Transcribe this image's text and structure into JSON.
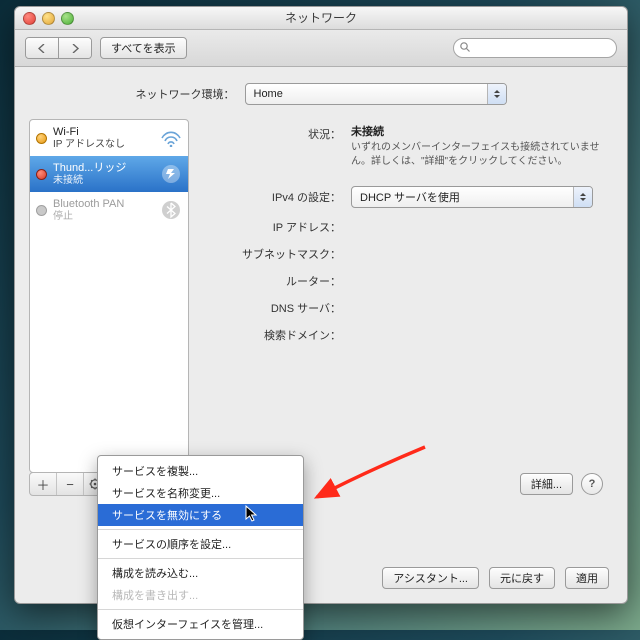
{
  "window": {
    "title": "ネットワーク"
  },
  "toolbar": {
    "show_all": "すべてを表示"
  },
  "search": {
    "placeholder": ""
  },
  "env": {
    "label": "ネットワーク環境：",
    "value": "Home"
  },
  "sidebar": {
    "items": [
      {
        "name": "Wi-Fi",
        "status_line": "IP アドレスなし",
        "dot": "o",
        "icon": "wifi"
      },
      {
        "name": "Thund...リッジ",
        "status_line": "未接続",
        "dot": "r",
        "icon": "tbridge"
      },
      {
        "name": "Bluetooth PAN",
        "status_line": "停止",
        "dot": "",
        "icon": "bt"
      }
    ]
  },
  "detail": {
    "rows": {
      "status_label": "状況：",
      "status_value": "未接続",
      "status_hint": "いずれのメンバーインターフェイスも接続されていません。詳しくは、\"詳細\"をクリックしてください。",
      "ipv4_label": "IPv4 の設定：",
      "ipv4_value": "DHCP サーバを使用",
      "ip_label": "IP アドレス：",
      "mask_label": "サブネットマスク：",
      "router_label": "ルーター：",
      "dns_label": "DNS サーバ：",
      "search_label": "検索ドメイン："
    },
    "advanced": "詳細...",
    "help": "?"
  },
  "footer_buttons": {
    "assistant": "アシスタント...",
    "revert": "元に戻す",
    "apply": "適用"
  },
  "action_menu": {
    "items": [
      "サービスを複製...",
      "サービスを名称変更...",
      "サービスを無効にする",
      "サービスの順序を設定...",
      "構成を読み込む...",
      "構成を書き出す...",
      "仮想インターフェイスを管理..."
    ]
  }
}
